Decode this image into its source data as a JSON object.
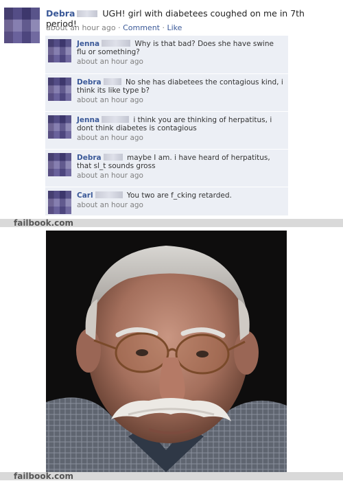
{
  "post": {
    "author": "Debra",
    "text": "UGH! girl with diabetees coughed on me in 7th period!",
    "time": "about an hour ago",
    "comment_link": "Comment",
    "like_link": "Like",
    "separator": "·"
  },
  "comments": [
    {
      "author": "Jenna",
      "text": "Why is that bad? Does she have swine flu or something?",
      "time": "about an hour ago"
    },
    {
      "author": "Debra",
      "text": "No she has diabetees the contagious kind, i think its like type b?",
      "time": "about an hour ago"
    },
    {
      "author": "Jenna",
      "text": "i think you are thinking of herpatitus, i dont think diabetes is contagious",
      "time": "about an hour ago"
    },
    {
      "author": "Debra",
      "text": "maybe I am. i have heard of herpatitus, that sl_t sounds gross",
      "time": "about an hour ago"
    },
    {
      "author": "Carl",
      "text": "You two are f_cking retarded.",
      "time": "about an hour ago"
    }
  ],
  "watermark": {
    "top": "failbook.com",
    "bottom": "failbook.com"
  },
  "photo": {
    "subject": "portrait of an older man with glasses and a white mustache"
  }
}
